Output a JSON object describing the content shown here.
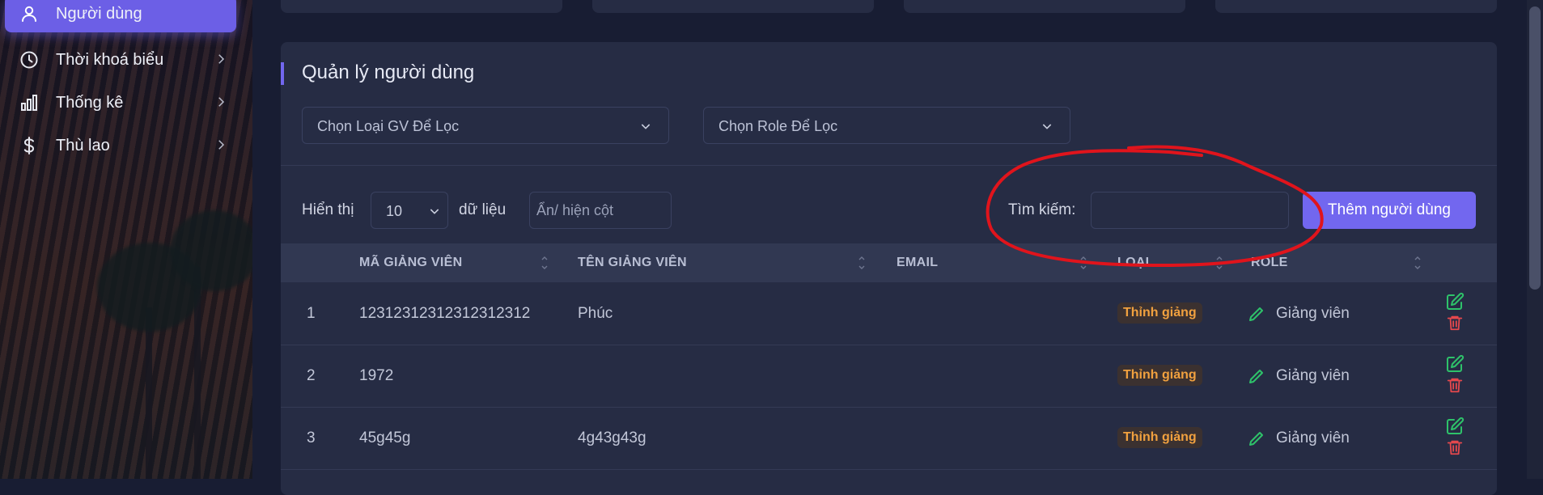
{
  "sidebar": {
    "items": [
      {
        "label": "Người dùng",
        "icon": "user-icon",
        "active": true
      },
      {
        "label": "Thời khoá biểu",
        "icon": "clock-icon",
        "active": false
      },
      {
        "label": "Thống kê",
        "icon": "bar-chart-icon",
        "active": false
      },
      {
        "label": "Thù lao",
        "icon": "dollar-icon",
        "active": false
      }
    ]
  },
  "panel": {
    "title": "Quản lý người dùng",
    "filters": {
      "type_placeholder": "Chọn Loại GV Để Lọc",
      "role_placeholder": "Chọn Role Để Lọc"
    },
    "controls": {
      "show_label": "Hiển thị",
      "page_size": "10",
      "data_label": "dữ liệu",
      "column_toggle": "Ẩn/ hiện cột",
      "search_label": "Tìm kiếm:",
      "search_value": "",
      "add_button": "Thêm người dùng"
    },
    "table": {
      "columns": [
        "MÃ GIẢNG VIÊN",
        "TÊN GIẢNG VIÊN",
        "EMAIL",
        "LOẠI",
        "ROLE"
      ],
      "rows": [
        {
          "index": "1",
          "code": "12312312312312312312",
          "name": "Phúc",
          "email": "",
          "type": "Thỉnh giảng",
          "role": "Giảng viên"
        },
        {
          "index": "2",
          "code": "1972",
          "name": "",
          "email": "",
          "type": "Thỉnh giảng",
          "role": "Giảng viên"
        },
        {
          "index": "3",
          "code": "45g45g",
          "name": "4g43g43g",
          "email": "",
          "type": "Thỉnh giảng",
          "role": "Giảng viên"
        }
      ]
    }
  },
  "colors": {
    "accent": "#7267ef",
    "panel_bg": "#262c44",
    "page_bg": "#181d33",
    "badge_text": "#f1a13f",
    "edit_icon": "#2ec26a",
    "delete_icon": "#e5484d",
    "annotation": "#e0141c"
  }
}
